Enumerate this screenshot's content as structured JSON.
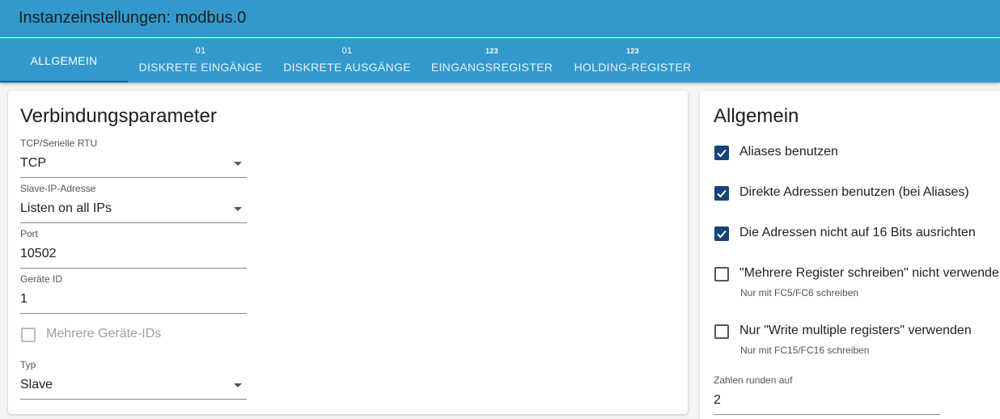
{
  "header": {
    "title": "Instanzeinstellungen: modbus.0"
  },
  "tabs": [
    {
      "badge": "",
      "label": "ALLGEMEIN"
    },
    {
      "badge": "01",
      "label": "DISKRETE EINGÄNGE"
    },
    {
      "badge": "01",
      "label": "DISKRETE AUSGÄNGE"
    },
    {
      "badge": "123",
      "label": "EINGANGSREGISTER"
    },
    {
      "badge": "123",
      "label": "HOLDING-REGISTER"
    }
  ],
  "left": {
    "title": "Verbindungsparameter",
    "fields": [
      {
        "label": "TCP/Serielle RTU",
        "value": "TCP"
      },
      {
        "label": "Slave-IP-Adresse",
        "value": "Listen on all IPs"
      },
      {
        "label": "Port",
        "value": "10502"
      },
      {
        "label": "Geräte ID",
        "value": "1"
      }
    ],
    "multi_ids": {
      "label": "Mehrere Geräte-IDs",
      "checked": false
    },
    "type_field": {
      "label": "Typ",
      "value": "Slave"
    }
  },
  "right": {
    "title": "Allgemein",
    "checkboxes": [
      {
        "label": "Aliases benutzen",
        "checked": true,
        "help": ""
      },
      {
        "label": "Direkte Adressen benutzen (bei Aliases)",
        "checked": true,
        "help": ""
      },
      {
        "label": "Die Adressen nicht auf 16 Bits ausrichten",
        "checked": true,
        "help": ""
      },
      {
        "label": "\"Mehrere Register schreiben\" nicht verwende",
        "checked": false,
        "help": "Nur mit FC5/FC6 schreiben"
      },
      {
        "label": "Nur \"Write multiple registers\" verwenden",
        "checked": false,
        "help": "Nur mit FC15/FC16 schreiben"
      }
    ],
    "round_field": {
      "label": "Zahlen runden auf",
      "value": "2"
    }
  },
  "colors": {
    "header": "#3399cc",
    "checkbox": "#164477"
  }
}
